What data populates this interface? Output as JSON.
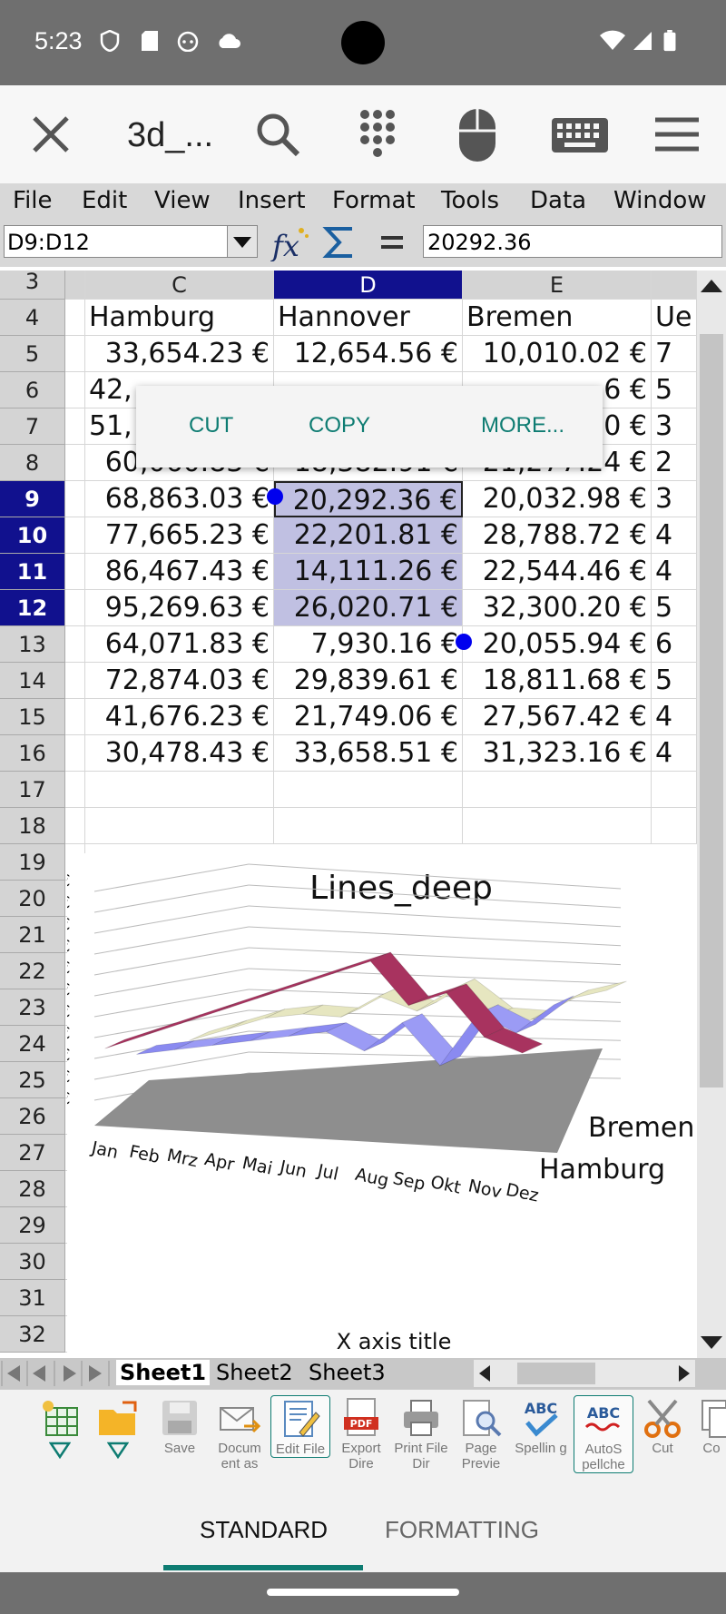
{
  "status": {
    "time": "5:23"
  },
  "toolbar": {
    "doc_title": "3d_..."
  },
  "menu": [
    "File",
    "Edit",
    "View",
    "Insert",
    "Format",
    "Tools",
    "Data",
    "Window"
  ],
  "formula": {
    "name_box": "D9:D12",
    "value": "20292.36"
  },
  "columns": [
    "C",
    "D",
    "E"
  ],
  "rows_visible": [
    "3",
    "4",
    "5",
    "6",
    "7",
    "8",
    "9",
    "10",
    "11",
    "12",
    "13",
    "14",
    "15",
    "16",
    "17",
    "18",
    "19",
    "20",
    "21",
    "22",
    "23",
    "24",
    "25",
    "26",
    "27",
    "28",
    "29",
    "30",
    "31",
    "32"
  ],
  "table": {
    "headers": [
      "Hamburg",
      "Hannover",
      "Bremen",
      "Ue"
    ],
    "rows": [
      [
        "33,654.23 €",
        "12,654.56 €",
        "10,010.02 €",
        "7"
      ],
      [
        "42,",
        "",
        "6 €",
        "5"
      ],
      [
        "51,",
        "",
        "0 €",
        "3"
      ],
      [
        "60,060.83 €",
        "18,382.91 €",
        "21,277.24 €",
        "2"
      ],
      [
        "68,863.03 €",
        "20,292.36 €",
        "20,032.98 €",
        "3"
      ],
      [
        "77,665.23 €",
        "22,201.81 €",
        "28,788.72 €",
        "4"
      ],
      [
        "86,467.43 €",
        "14,111.26 €",
        "22,544.46 €",
        "4"
      ],
      [
        "95,269.63 €",
        "26,020.71 €",
        "32,300.20 €",
        "5"
      ],
      [
        "64,071.83 €",
        "7,930.16 €",
        "20,055.94 €",
        "6"
      ],
      [
        "72,874.03 €",
        "29,839.61 €",
        "18,811.68 €",
        "5"
      ],
      [
        "41,676.23 €",
        "21,749.06 €",
        "27,567.42 €",
        "4"
      ],
      [
        "30,478.43 €",
        "33,658.51 €",
        "31,323.16 €",
        "4"
      ]
    ]
  },
  "context_menu": [
    "CUT",
    "COPY",
    "MORE..."
  ],
  "chart_data": {
    "type": "line",
    "title": "Lines_deep",
    "xlabel": "X axis title",
    "categories": [
      "Jan",
      "Feb",
      "Mrz",
      "Apr",
      "Mai",
      "Jun",
      "Jul",
      "Aug",
      "Sep",
      "Okt",
      "Nov",
      "Dez"
    ],
    "depth_labels": [
      "Bremen",
      "Hamburg"
    ],
    "ytick_labels": [
      "€",
      "€",
      "€",
      "€",
      "€",
      "€",
      "€",
      "€",
      "€",
      "€",
      "€"
    ],
    "series": [
      {
        "name": "Hamburg",
        "values": [
          33654.23,
          42456.43,
          51258.63,
          60060.83,
          68863.03,
          77665.23,
          86467.43,
          95269.63,
          64071.83,
          72874.03,
          41676.23,
          30478.43
        ]
      },
      {
        "name": "Hannover",
        "values": [
          12654.56,
          14564.01,
          16473.46,
          18382.91,
          20292.36,
          22201.81,
          14111.26,
          26020.71,
          7930.16,
          29839.61,
          21749.06,
          33658.51
        ]
      },
      {
        "name": "Bremen",
        "values": [
          10010.02,
          14765.76,
          19521.5,
          21277.24,
          20032.98,
          28788.72,
          22544.46,
          32300.2,
          20055.94,
          18811.68,
          27567.42,
          31323.16
        ]
      }
    ],
    "colors": [
      "#353566",
      "#9b9bf5",
      "#a8335f",
      "#ffffd8",
      "#c8f7f7",
      "#7a7a5a"
    ]
  },
  "sheets": [
    "Sheet1",
    "Sheet2",
    "Sheet3"
  ],
  "bottom_toolbar": [
    "",
    "",
    "Save",
    "Docum ent as",
    "Edit File",
    "Export Dire",
    "Print File Dir",
    "Page Previe",
    "Spellin g",
    "AutoS pellche",
    "Cut",
    "Co"
  ],
  "mode_tabs": [
    "STANDARD",
    "FORMATTING"
  ],
  "colors": {
    "selection": "#11118e",
    "accent": "#0e7c72",
    "sel_fill": "#c0c0e2"
  }
}
